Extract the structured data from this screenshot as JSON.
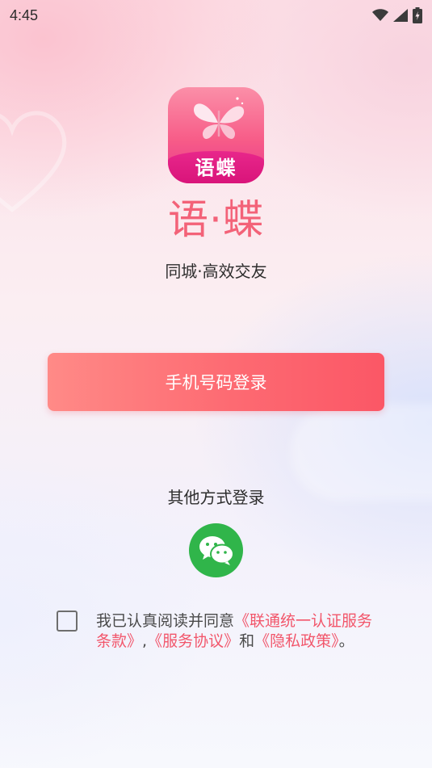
{
  "status_bar": {
    "time": "4:45",
    "icons": [
      "wifi-icon",
      "signal-icon",
      "battery-charging-icon"
    ]
  },
  "app": {
    "icon_text": "语蝶",
    "name": "语·蝶",
    "slogan": "同城·高效交友"
  },
  "login": {
    "phone_button_label": "手机号码登录",
    "other_methods_title": "其他方式登录",
    "wechat_icon": "wechat-icon"
  },
  "agreement": {
    "prefix": "我已认真阅读并同意",
    "link_1": "《联通统一认证服务条款》",
    "separator": ",",
    "link_2": "《服务协议》",
    "conjunction": "和",
    "link_3": "《隐私政策》",
    "suffix": "。",
    "checked": false
  },
  "colors": {
    "brand_pink": "#f36278",
    "button_gradient_start": "#ff8a87",
    "button_gradient_end": "#fb5766",
    "wechat_green": "#30b54a",
    "link": "#f2566b"
  }
}
